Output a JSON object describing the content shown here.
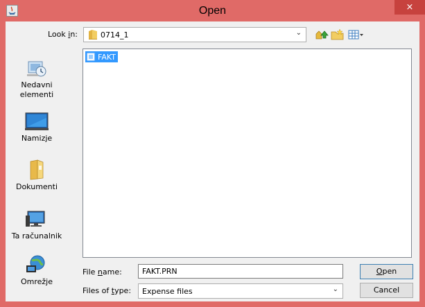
{
  "window": {
    "title": "Open",
    "close_glyph": "×",
    "accent_color": "#e06a67",
    "app_icon": "java-icon"
  },
  "look_in": {
    "label_prefix": "Look ",
    "label_underlined": "i",
    "label_suffix": "n:",
    "value": "0714_1",
    "icon": "folder-icon"
  },
  "toolbar": {
    "buttons": [
      "up-one-level-icon",
      "create-new-folder-icon",
      "view-menu-icon"
    ]
  },
  "places": [
    {
      "label_line1": "Nedavni",
      "label_line2": "elementi",
      "icon": "recent-items-icon"
    },
    {
      "label_line1": "Namizje",
      "label_line2": "",
      "icon": "desktop-icon"
    },
    {
      "label_line1": "Dokumenti",
      "label_line2": "",
      "icon": "documents-icon"
    },
    {
      "label_line1": "Ta računalnik",
      "label_line2": "",
      "icon": "computer-icon"
    },
    {
      "label_line1": "Omrežje",
      "label_line2": "",
      "icon": "network-icon"
    }
  ],
  "files": [
    {
      "name": "FAKT",
      "selected": true,
      "icon": "file-icon"
    }
  ],
  "file_name": {
    "label_prefix": "File ",
    "label_underlined": "n",
    "label_suffix": "ame:",
    "value": "FAKT.PRN"
  },
  "file_type": {
    "label_prefix": "Files of ",
    "label_underlined": "t",
    "label_suffix": "ype:",
    "value": "Expense files"
  },
  "buttons": {
    "open_underlined": "O",
    "open_rest": "pen",
    "cancel": "Cancel"
  }
}
